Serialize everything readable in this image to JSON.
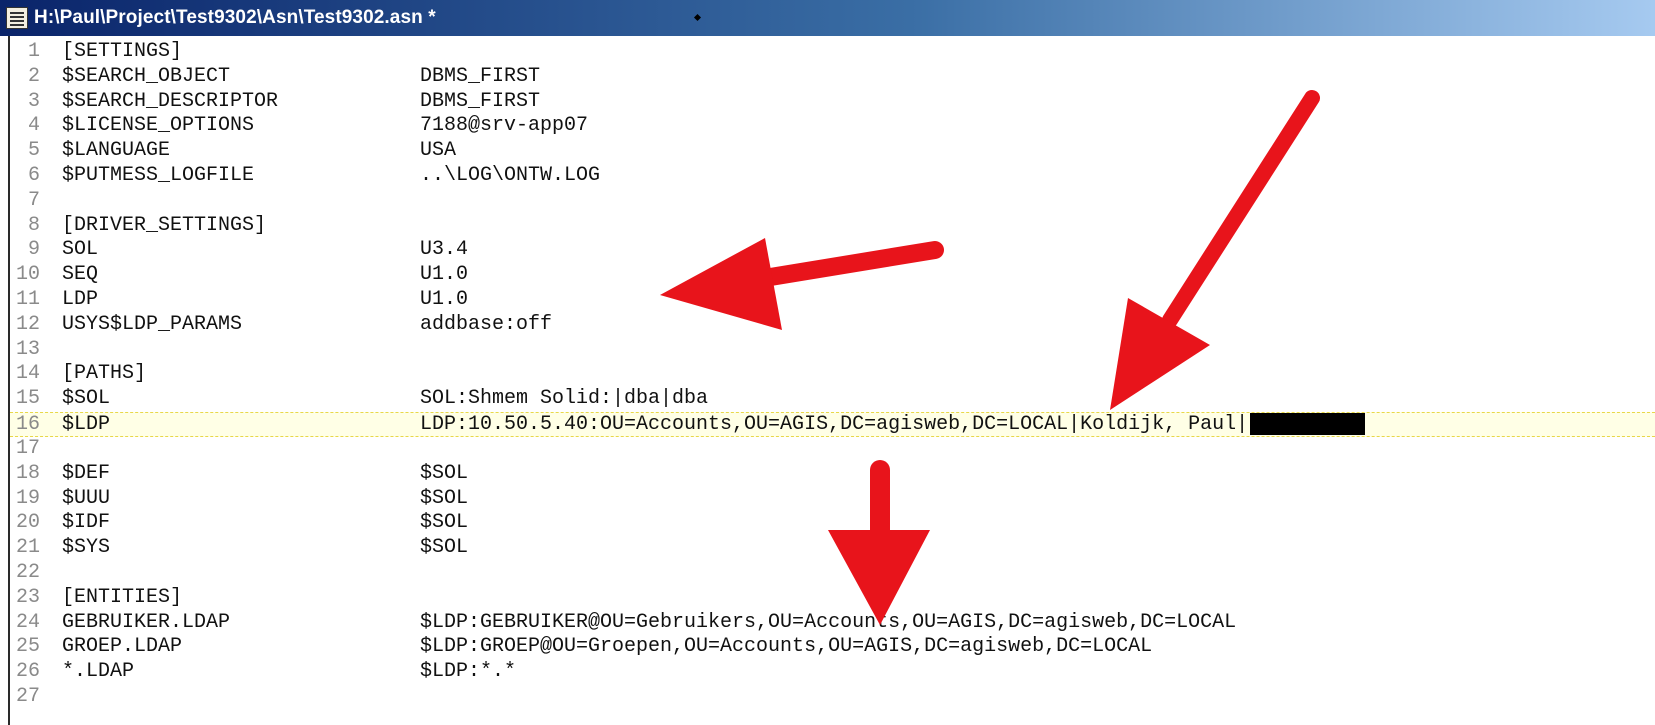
{
  "window": {
    "title": "H:\\Paul\\Project\\Test9302\\Asn\\Test9302.asn *"
  },
  "editor": {
    "current_line": 16,
    "lines": [
      {
        "n": "1",
        "key": "[SETTINGS]",
        "value": ""
      },
      {
        "n": "2",
        "key": "$SEARCH_OBJECT",
        "value": "DBMS_FIRST"
      },
      {
        "n": "3",
        "key": "$SEARCH_DESCRIPTOR",
        "value": "DBMS_FIRST"
      },
      {
        "n": "4",
        "key": "$LICENSE_OPTIONS",
        "value": "7188@srv-app07"
      },
      {
        "n": "5",
        "key": "$LANGUAGE",
        "value": "USA"
      },
      {
        "n": "6",
        "key": "$PUTMESS_LOGFILE",
        "value": "..\\LOG\\ONTW.LOG"
      },
      {
        "n": "7",
        "key": "",
        "value": ""
      },
      {
        "n": "8",
        "key": "[DRIVER_SETTINGS]",
        "value": ""
      },
      {
        "n": "9",
        "key": "SOL",
        "value": "U3.4"
      },
      {
        "n": "10",
        "key": "SEQ",
        "value": "U1.0"
      },
      {
        "n": "11",
        "key": "LDP",
        "value": "U1.0"
      },
      {
        "n": "12",
        "key": "USYS$LDP_PARAMS",
        "value": "addbase:off"
      },
      {
        "n": "13",
        "key": "",
        "value": ""
      },
      {
        "n": "14",
        "key": "[PATHS]",
        "value": ""
      },
      {
        "n": "15",
        "key": "$SOL",
        "value": "SOL:Shmem Solid:|dba|dba"
      },
      {
        "n": "16",
        "key": "$LDP",
        "value": "LDP:10.50.5.40:OU=Accounts,OU=AGIS,DC=agisweb,DC=LOCAL|Koldijk, Paul|"
      },
      {
        "n": "17",
        "key": "",
        "value": ""
      },
      {
        "n": "18",
        "key": "$DEF",
        "value": "$SOL"
      },
      {
        "n": "19",
        "key": "$UUU",
        "value": "$SOL"
      },
      {
        "n": "20",
        "key": "$IDF",
        "value": "$SOL"
      },
      {
        "n": "21",
        "key": "$SYS",
        "value": "$SOL"
      },
      {
        "n": "22",
        "key": "",
        "value": ""
      },
      {
        "n": "23",
        "key": "[ENTITIES]",
        "value": ""
      },
      {
        "n": "24",
        "key": "GEBRUIKER.LDAP",
        "value": "$LDP:GEBRUIKER@OU=Gebruikers,OU=Accounts,OU=AGIS,DC=agisweb,DC=LOCAL"
      },
      {
        "n": "25",
        "key": "GROEP.LDAP",
        "value": "$LDP:GROEP@OU=Groepen,OU=Accounts,OU=AGIS,DC=agisweb,DC=LOCAL"
      },
      {
        "n": "26",
        "key": "*.LDAP",
        "value": "$LDP:*.*"
      },
      {
        "n": "27",
        "key": "",
        "value": ""
      }
    ]
  },
  "annotations": {
    "arrow_color": "#e8141b",
    "arrow_count": 3
  },
  "colors": {
    "titlebar_start": "#0a246a",
    "titlebar_end": "#a6caf0",
    "line_number": "#8a8a8a",
    "current_line_bg": "#ffffe6"
  }
}
